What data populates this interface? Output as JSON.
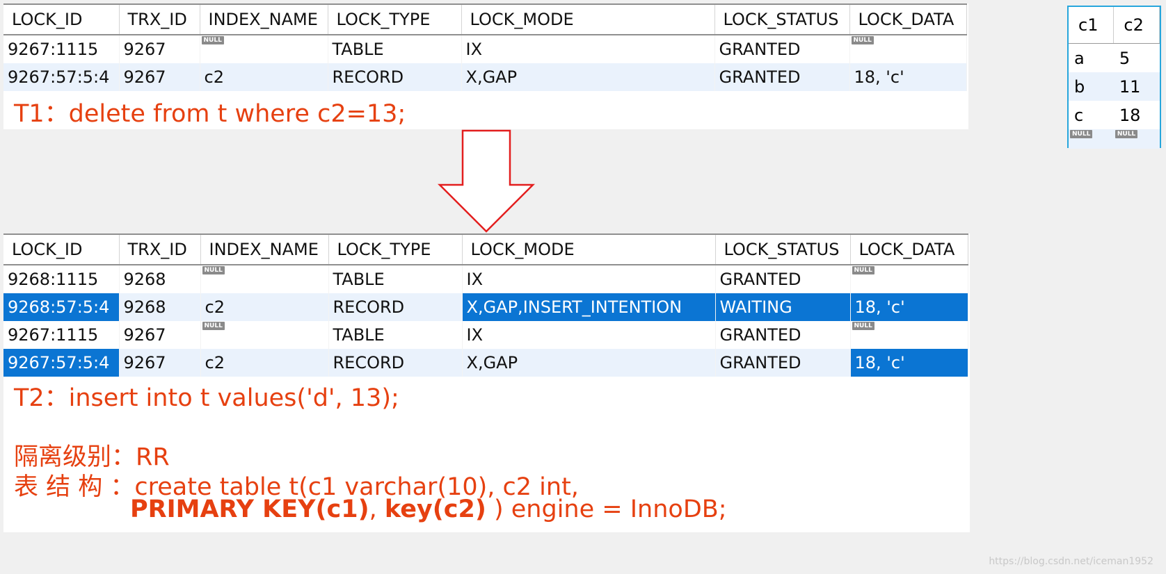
{
  "columns": [
    "LOCK_ID",
    "TRX_ID",
    "INDEX_NAME",
    "LOCK_TYPE",
    "LOCK_MODE",
    "LOCK_STATUS",
    "LOCK_DATA"
  ],
  "null_badge": "NULL",
  "t1": {
    "rows": [
      {
        "lock_id": "9267:1115",
        "trx_id": "9267",
        "index_name": "",
        "lock_type": "TABLE",
        "lock_mode": "IX",
        "lock_status": "GRANTED",
        "lock_data": ""
      },
      {
        "lock_id": "9267:57:5:4",
        "trx_id": "9267",
        "index_name": "c2",
        "lock_type": "RECORD",
        "lock_mode": "X,GAP",
        "lock_status": "GRANTED",
        "lock_data": "18, 'c'"
      }
    ],
    "caption": "T1：delete from t where c2=13;"
  },
  "t2": {
    "rows": [
      {
        "lock_id": "9268:1115",
        "trx_id": "9268",
        "index_name": "",
        "lock_type": "TABLE",
        "lock_mode": "IX",
        "lock_status": "GRANTED",
        "lock_data": ""
      },
      {
        "lock_id": "9268:57:5:4",
        "trx_id": "9268",
        "index_name": "c2",
        "lock_type": "RECORD",
        "lock_mode": "X,GAP,INSERT_INTENTION",
        "lock_status": "WAITING",
        "lock_data": "18, 'c'"
      },
      {
        "lock_id": "9267:1115",
        "trx_id": "9267",
        "index_name": "",
        "lock_type": "TABLE",
        "lock_mode": "IX",
        "lock_status": "GRANTED",
        "lock_data": ""
      },
      {
        "lock_id": "9267:57:5:4",
        "trx_id": "9267",
        "index_name": "c2",
        "lock_type": "RECORD",
        "lock_mode": "X,GAP",
        "lock_status": "GRANTED",
        "lock_data": "18, 'c'"
      }
    ],
    "caption": "T2：insert into t values('d', 13);"
  },
  "notes": {
    "isolation": "隔离级别：RR",
    "schema_label": "表 结 构 ：",
    "schema_line1": "create table t(c1 varchar(10), c2 int,",
    "schema_pk": "PRIMARY KEY(c1)",
    "schema_sep": ",",
    "schema_key": "key(c2)",
    "schema_tail": ") engine = InnoDB;"
  },
  "side_table": {
    "columns": [
      "c1",
      "c2"
    ],
    "rows": [
      [
        "a",
        "5"
      ],
      [
        "b",
        "11"
      ],
      [
        "c",
        "18"
      ]
    ]
  },
  "arrow_icon": "down-arrow-icon",
  "colors": {
    "accent": "#e64010",
    "selection": "#0b75d3",
    "frame": "#27a6dc",
    "arrow": "#e31e1e"
  },
  "watermark": "https://blog.csdn.net/iceman1952"
}
